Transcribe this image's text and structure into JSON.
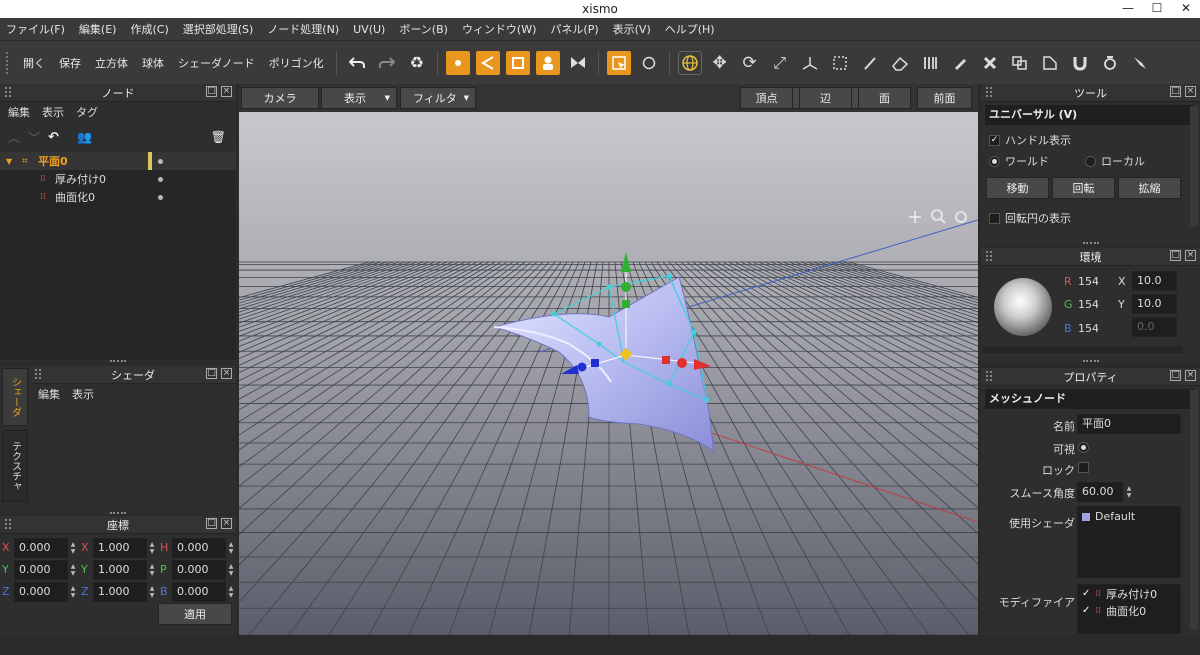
{
  "app_title": "xismo",
  "menu": [
    "ファイル(F)",
    "編集(E)",
    "作成(C)",
    "選択部処理(S)",
    "ノード処理(N)",
    "UV(U)",
    "ボーン(B)",
    "ウィンドウ(W)",
    "パネル(P)",
    "表示(V)",
    "ヘルプ(H)"
  ],
  "toolbar_text": [
    "開く",
    "保存",
    "立方体",
    "球体",
    "シェーダノード",
    "ポリゴン化"
  ],
  "node_panel": {
    "title": "ノード",
    "menu": [
      "編集",
      "表示",
      "タグ"
    ],
    "items": [
      {
        "label": "平面0"
      },
      {
        "label": "厚み付け0"
      },
      {
        "label": "曲面化0"
      }
    ]
  },
  "shader_panel": {
    "title": "シェーダ",
    "menu": [
      "編集",
      "表示"
    ],
    "tabs": [
      "シェーダ",
      "テクスチャ"
    ]
  },
  "coord_panel": {
    "title": "座標",
    "rows": [
      [
        {
          "label": "X",
          "value": "0.000"
        },
        {
          "label": "X",
          "value": "1.000"
        },
        {
          "label": "H",
          "value": "0.000"
        }
      ],
      [
        {
          "label": "Y",
          "value": "0.000"
        },
        {
          "label": "Y",
          "value": "1.000"
        },
        {
          "label": "P",
          "value": "0.000"
        }
      ],
      [
        {
          "label": "Z",
          "value": "0.000"
        },
        {
          "label": "Z",
          "value": "1.000"
        },
        {
          "label": "B",
          "value": "0.000"
        }
      ]
    ],
    "apply": "適用"
  },
  "viewport": {
    "left_buttons": [
      "カメラ",
      "表示",
      "フィルタ"
    ],
    "right_buttons": [
      "頂点",
      "辺",
      "面",
      "前面"
    ]
  },
  "tool_panel": {
    "title": "ツール",
    "mode": "ユニバーサル (V)",
    "handle_label": "ハンドル表示",
    "world": "ワールド",
    "local": "ローカル",
    "buttons": [
      "移動",
      "回転",
      "拡縮"
    ],
    "rotation_circle": "回転円の表示"
  },
  "env_panel": {
    "title": "環境",
    "r_label": "R",
    "r": "154",
    "g_label": "G",
    "g": "154",
    "b_label": "B",
    "b": "154",
    "x_label": "X",
    "x": "10.0",
    "y_label": "Y",
    "y": "10.0",
    "z": "0.0"
  },
  "prop_panel": {
    "title": "プロパティ",
    "section": "メッシュノード",
    "name_label": "名前",
    "name": "平面0",
    "visible_label": "可視",
    "lock_label": "ロック",
    "smooth_label": "スムース角度",
    "smooth": "60.00",
    "shader_label": "使用シェーダ",
    "shader": "Default",
    "modifier_label": "モディファイア",
    "modifiers": [
      "厚み付け0",
      "曲面化0"
    ]
  },
  "colors": {
    "accent": "#e8961e",
    "node_selected": "#f0a020",
    "handle": "#40d0e0"
  }
}
